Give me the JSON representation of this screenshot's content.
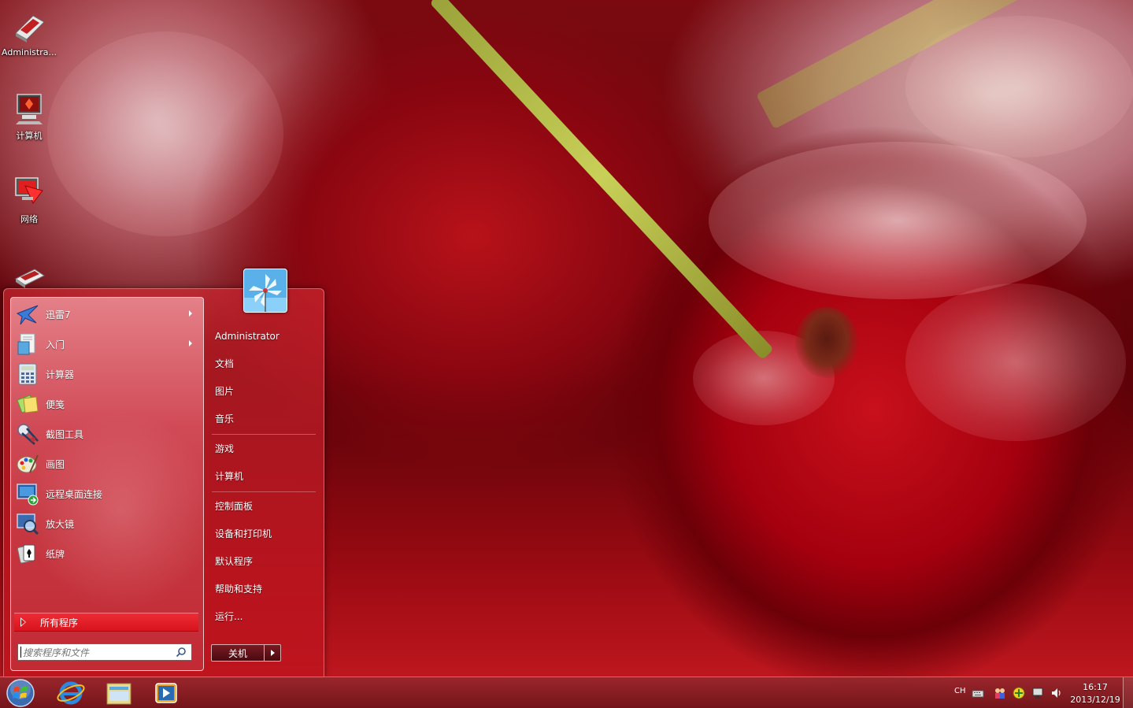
{
  "desktop": {
    "icons": [
      {
        "label": "Administra...",
        "icon": "user-folder-icon"
      },
      {
        "label": "计算机",
        "icon": "computer-icon"
      },
      {
        "label": "网络",
        "icon": "network-icon"
      },
      {
        "label": "",
        "icon": "book-icon"
      }
    ]
  },
  "start_menu": {
    "programs": [
      {
        "label": "迅雷7",
        "icon": "thunder-bird-icon",
        "has_submenu": true
      },
      {
        "label": "入门",
        "icon": "getting-started-icon",
        "has_submenu": true
      },
      {
        "label": "计算器",
        "icon": "calculator-icon",
        "has_submenu": false
      },
      {
        "label": "便笺",
        "icon": "sticky-notes-icon",
        "has_submenu": false
      },
      {
        "label": "截图工具",
        "icon": "snipping-tool-icon",
        "has_submenu": false
      },
      {
        "label": "画图",
        "icon": "paint-icon",
        "has_submenu": false
      },
      {
        "label": "远程桌面连接",
        "icon": "remote-desktop-icon",
        "has_submenu": false
      },
      {
        "label": "放大镜",
        "icon": "magnifier-icon",
        "has_submenu": false
      },
      {
        "label": "纸牌",
        "icon": "solitaire-icon",
        "has_submenu": false
      }
    ],
    "all_programs": "所有程序",
    "search_placeholder": "搜索程序和文件",
    "places": {
      "user": "Administrator",
      "documents": "文档",
      "pictures": "图片",
      "music": "音乐",
      "games": "游戏",
      "computer": "计算机",
      "control_panel": "控制面板",
      "devices_printers": "设备和打印机",
      "default_programs": "默认程序",
      "help_support": "帮助和支持",
      "run": "运行..."
    },
    "shutdown_label": "关机"
  },
  "taskbar": {
    "pinned": [
      "ie-icon",
      "explorer-icon",
      "media-player-icon"
    ],
    "language": "CH",
    "time": "16:17",
    "date": "2013/12/19"
  },
  "colors": {
    "accent": "#d8141e",
    "menu_bg": "#c63842",
    "taskbar": "#8a1e24"
  }
}
